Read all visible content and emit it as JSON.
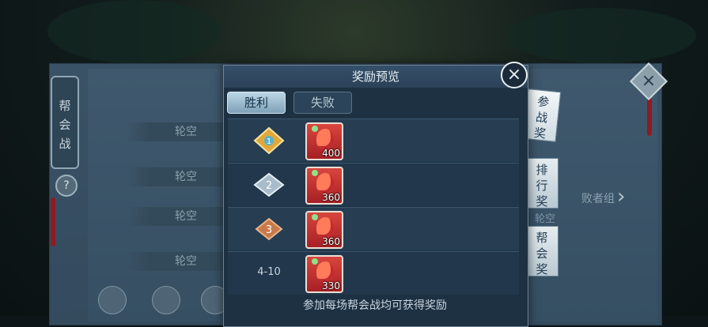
{
  "left_scroll": {
    "chars": [
      "帮",
      "会",
      "战"
    ]
  },
  "help_label": "?",
  "slots": [
    "轮空",
    "轮空",
    "轮空",
    "轮空"
  ],
  "right_close_label": "×",
  "losers_group": "败者组",
  "losers_arrow": "›",
  "dim_slot": "轮空",
  "modal": {
    "title": "奖励预览",
    "close_label": "×",
    "tabs": [
      {
        "label": "胜利",
        "active": true
      },
      {
        "label": "失败",
        "active": false
      }
    ],
    "rows": [
      {
        "rank_icon": "rank-1-medal-icon",
        "quantity": "400"
      },
      {
        "rank_icon": "rank-2-medal-icon",
        "quantity": "360"
      },
      {
        "rank_icon": "rank-3-medal-icon",
        "quantity": "360"
      },
      {
        "rank_text": "4-10",
        "quantity": "330"
      }
    ],
    "footer": "参加每场帮会战均可获得奖励"
  },
  "side_tabs": [
    {
      "chars": [
        "参",
        "战",
        "奖"
      ],
      "active": true
    },
    {
      "chars": [
        "排",
        "行",
        "奖"
      ],
      "active": false
    },
    {
      "chars": [
        "帮",
        "会",
        "奖"
      ],
      "active": false
    }
  ],
  "colors": {
    "accent": "#bcd6e6",
    "reward_red": "#c62f30",
    "gold": "#e0a83a"
  }
}
